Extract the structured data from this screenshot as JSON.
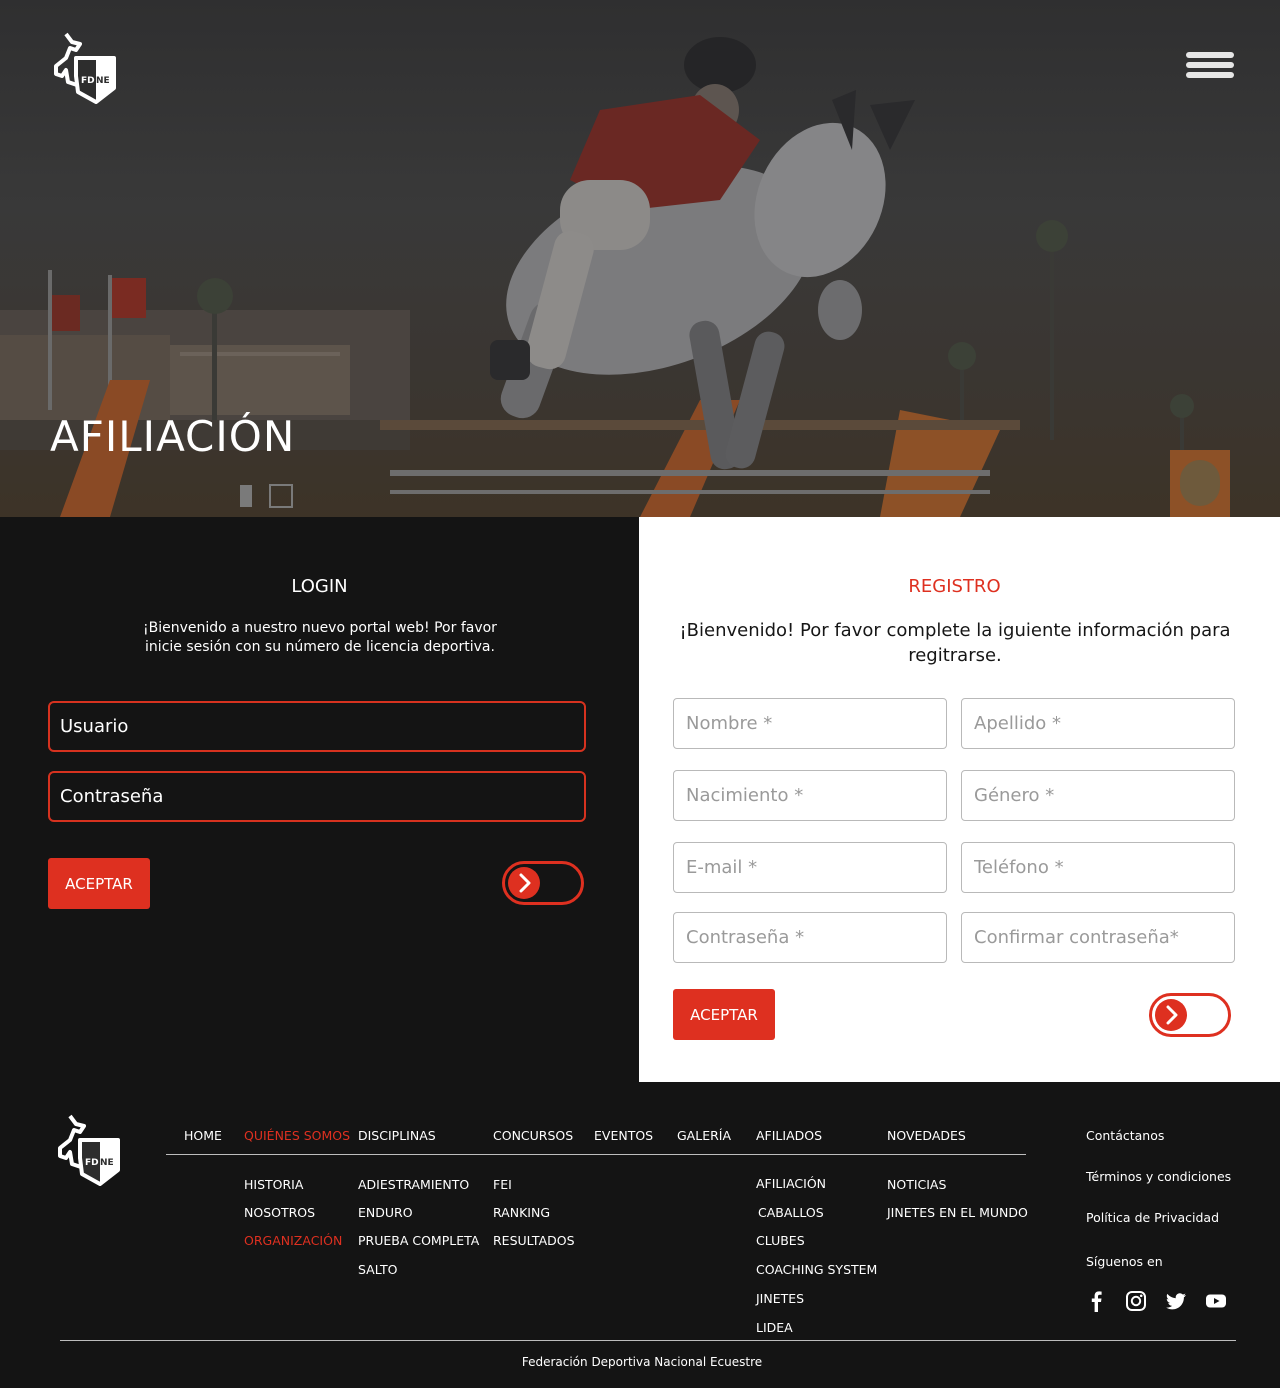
{
  "hero": {
    "title": "AFILIACIÓN",
    "logo_text": "FDNE",
    "menu_icon": "hamburger-menu-icon"
  },
  "login": {
    "title": "LOGIN",
    "description": "¡Bienvenido a nuestro nuevo portal web! Por favor inicie sesión con su número de licencia deportiva.",
    "user_placeholder": "Usuario",
    "password_placeholder": "Contraseña",
    "submit_label": "ACEPTAR"
  },
  "registro": {
    "title": "REGISTRO",
    "description": "¡Bienvenido! Por favor complete la iguiente información para regitrarse.",
    "fields": {
      "nombre": "Nombre *",
      "apellido": "Apellido *",
      "nacimiento": "Nacimiento *",
      "genero": "Género *",
      "email": "E-mail *",
      "telefono": "Teléfono *",
      "contrasena": "Contraseña *",
      "confirmar": "Confirmar contraseña*"
    },
    "submit_label": "ACEPTAR"
  },
  "footer": {
    "logo_text": "FDNE",
    "nav": {
      "home": "HOME",
      "quienes": "QUIÉNES SOMOS",
      "disciplinas": "DISCIPLINAS",
      "concursos": "CONCURSOS",
      "eventos": "EVENTOS",
      "galeria": "GALERÍA",
      "afiliados": "AFILIADOS",
      "novedades": "NOVEDADES"
    },
    "quienes_sub": [
      "HISTORIA",
      "NOSOTROS",
      "ORGANIZACIÓN"
    ],
    "disciplinas_sub": [
      "ADIESTRAMIENTO",
      "ENDURO",
      "PRUEBA COMPLETA",
      "SALTO"
    ],
    "concursos_sub": [
      "FEI",
      "RANKING",
      "RESULTADOS"
    ],
    "afiliados_sub": [
      "AFILIACIÓN",
      "CABALLOS",
      "CLUBES",
      "COACHING SYSTEM",
      "JINETES",
      "LIDEA"
    ],
    "novedades_sub": [
      "NOTICIAS",
      "JINETES EN EL MUNDO"
    ],
    "contactanos": "Contáctanos",
    "terminos": "Términos y condiciones",
    "privacidad": "Política de Privacidad",
    "siguenos": "Síguenos en",
    "social_icons": [
      "facebook-icon",
      "instagram-icon",
      "twitter-icon",
      "youtube-icon"
    ],
    "copyright": "Federación Deportiva Nacional Ecuestre"
  },
  "colors": {
    "accent": "#de3020",
    "dark_bg": "#141414",
    "light_bg": "#ffffff"
  }
}
